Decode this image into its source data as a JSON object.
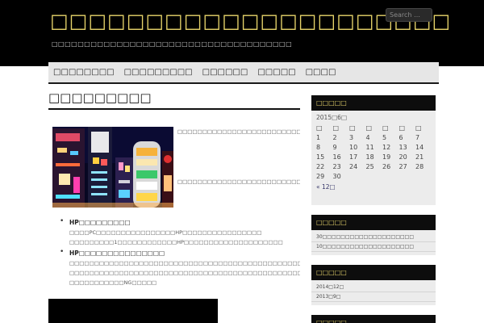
{
  "header": {
    "site_title": "□□□□□□□□□□□□□□□□□□□□□",
    "site_description": "□□□□□□□□□□□□□□□□□□□□□□□□□□□□□□□□□□□□□",
    "search_placeholder": "Search …"
  },
  "nav": {
    "items": [
      {
        "label": "□□□□□□□□"
      },
      {
        "label": "□□□□□□□□□"
      },
      {
        "label": "□□□□□□"
      },
      {
        "label": "□□□□□"
      },
      {
        "label": "□□□□"
      }
    ]
  },
  "post": {
    "title": "□□□□□□□□□",
    "para1_a": "□□□□□□□□□□□□□□□□□□□□□□□□□□□□□□□□□□□□□□□□□□□□□□□□□□□□□□□□□□□□□□□□□□□□□□",
    "para1_highlight": "□□□□□",
    "para1_b": "□□□□□□□□□□□□□□□□□□□□□□□□□□□□□□□",
    "para2": "□□□□□□□□□□□□□□□□□□□□□□□□□□□□□□□□□□□□□□□□□□□□□□□□□□□□□□□□",
    "features": [
      {
        "title": "HP□□□□□□□□□",
        "lines": [
          "□□□□PC□□□□□□□□□□□□□□□□HP□□□□□□□□□□□□□□□□",
          "□□□□□□□□□1□□□□□□□□□□□□HP□□□□□□□□□□□□□□□□□□□□"
        ]
      },
      {
        "title": "HP□□□□□□□□□□□□□□□",
        "lines": [
          "□□□□□□□□□□□□□□□□□□□□□□□□□□□□□□□□□□□□□□□□□□□□□□□□□□□□□□",
          "□□□□□□□□□□□□□□□□□□□□□□□□□□□□□□□□□□□□□□□□□□□□□□□□□□□□□□□□□□□□□□□□",
          "□□□□□□□□□□□NG□□□□□"
        ]
      }
    ]
  },
  "sidebar": {
    "calendar": {
      "title": "□□□□□",
      "caption": "2015□6□",
      "weekdays": [
        "□",
        "□",
        "□",
        "□",
        "□",
        "□",
        "□"
      ],
      "weeks": [
        [
          "1",
          "2",
          "3",
          "4",
          "5",
          "6",
          "7"
        ],
        [
          "8",
          "9",
          "10",
          "11",
          "12",
          "13",
          "14"
        ],
        [
          "15",
          "16",
          "17",
          "18",
          "19",
          "20",
          "21"
        ],
        [
          "22",
          "23",
          "24",
          "25",
          "26",
          "27",
          "28"
        ],
        [
          "29",
          "30",
          "",
          "",
          "",
          "",
          ""
        ]
      ],
      "prev_link": "« 12□"
    },
    "recent": {
      "title": "□□□□□",
      "items": [
        "30□□□□□□□□□□□□□□□□□□□□",
        "10□□□□□□□□□□□□□□□□□□□□"
      ]
    },
    "archive": {
      "title": "□□□□□",
      "items": [
        "2014□12□",
        "2013□9□"
      ]
    },
    "extra": {
      "title": "□□□□□"
    }
  }
}
